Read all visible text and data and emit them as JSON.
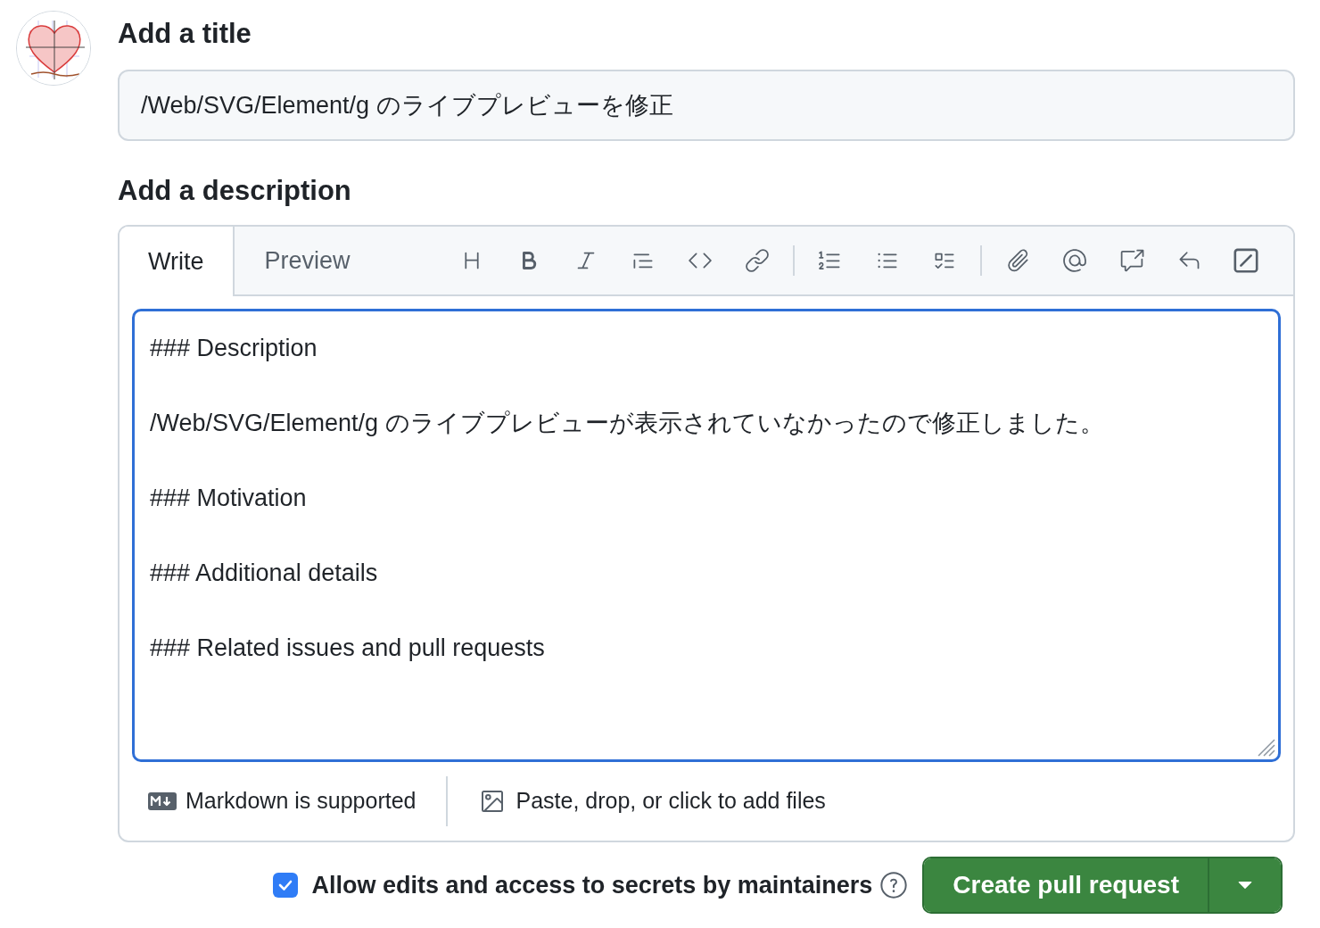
{
  "title_section": {
    "heading": "Add a title",
    "value": "/Web/SVG/Element/g のライブプレビューを修正"
  },
  "description_section": {
    "heading": "Add a description",
    "tabs": [
      {
        "label": "Write",
        "selected": true
      },
      {
        "label": "Preview",
        "selected": false
      }
    ],
    "body_lines": [
      "### Description",
      "/Web/SVG/Element/g のライブプレビューが表示されていなかったので修正しました。",
      "### Motivation",
      "### Additional details",
      "### Related issues and pull requests"
    ],
    "footer": {
      "markdown_note": "Markdown is supported",
      "attach_note": "Paste, drop, or click to add files"
    }
  },
  "maintainer_edits": {
    "label": "Allow edits and access to secrets by maintainers",
    "checked": true
  },
  "submit_button": {
    "label": "Create pull request"
  }
}
